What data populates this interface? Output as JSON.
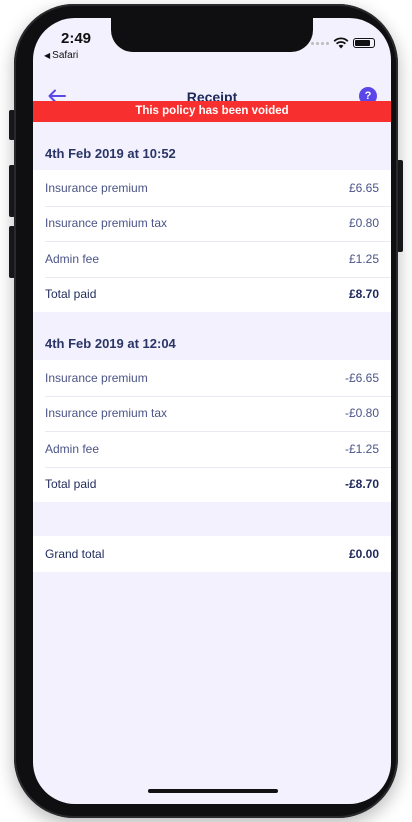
{
  "status_bar": {
    "time": "2:49",
    "back_app": "Safari"
  },
  "navbar": {
    "title": "Receipt",
    "help_label": "?"
  },
  "banner": {
    "text": "This policy has been voided",
    "color": "#f7302f"
  },
  "transactions": [
    {
      "date": "4th Feb 2019 at 10:52",
      "rows": [
        {
          "label": "Insurance premium",
          "value": "£6.65"
        },
        {
          "label": "Insurance premium tax",
          "value": "£0.80"
        },
        {
          "label": "Admin fee",
          "value": "£1.25"
        }
      ],
      "total": {
        "label": "Total paid",
        "value": "£8.70"
      }
    },
    {
      "date": "4th Feb 2019 at 12:04",
      "rows": [
        {
          "label": "Insurance premium",
          "value": "-£6.65"
        },
        {
          "label": "Insurance premium tax",
          "value": "-£0.80"
        },
        {
          "label": "Admin fee",
          "value": "-£1.25"
        }
      ],
      "total": {
        "label": "Total paid",
        "value": "-£8.70"
      }
    }
  ],
  "grand_total": {
    "label": "Grand total",
    "value": "£0.00"
  },
  "colors": {
    "accent": "#5b47e8",
    "title": "#1f2a5a",
    "background": "#f2f1fd"
  }
}
